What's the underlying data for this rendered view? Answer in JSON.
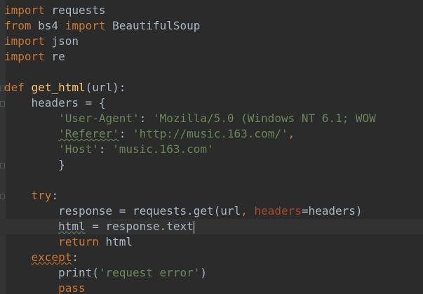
{
  "editor": {
    "language": "python",
    "colors": {
      "background": "#2b2b2b",
      "keyword": "#cc7832",
      "function": "#ffc66d",
      "string": "#6a8759",
      "plain": "#a9b7c6",
      "parameter": "#aa4926"
    },
    "lines": [
      {
        "tokens": [
          {
            "text": "import",
            "kind": "kw"
          },
          {
            "text": " requests",
            "kind": "pl"
          }
        ]
      },
      {
        "tokens": [
          {
            "text": "from",
            "kind": "kw"
          },
          {
            "text": " bs4 ",
            "kind": "pl"
          },
          {
            "text": "import",
            "kind": "kw"
          },
          {
            "text": " BeautifulSoup",
            "kind": "pl"
          }
        ]
      },
      {
        "tokens": [
          {
            "text": "import",
            "kind": "kw"
          },
          {
            "text": " json",
            "kind": "pl"
          }
        ]
      },
      {
        "tokens": [
          {
            "text": "import",
            "kind": "kw"
          },
          {
            "text": " re",
            "kind": "pl"
          }
        ]
      },
      {
        "tokens": []
      },
      {
        "tokens": [
          {
            "text": "def",
            "kind": "kw"
          },
          {
            "text": " ",
            "kind": "pl"
          },
          {
            "text": "get_html",
            "kind": "fn"
          },
          {
            "text": "(url):",
            "kind": "pl"
          }
        ]
      },
      {
        "tokens": [
          {
            "text": "    headers = {",
            "kind": "pl"
          }
        ]
      },
      {
        "tokens": [
          {
            "text": "        ",
            "kind": "pl"
          },
          {
            "text": "'User-Agent'",
            "kind": "str"
          },
          {
            "text": ": ",
            "kind": "pl"
          },
          {
            "text": "'Mozilla/5.0 (Windows NT 6.1; WOW",
            "kind": "str"
          }
        ]
      },
      {
        "tokens": [
          {
            "text": "        ",
            "kind": "pl"
          },
          {
            "text": "'Referer'",
            "kind": "str-under"
          },
          {
            "text": ": ",
            "kind": "pl"
          },
          {
            "text": "'http://music.163.com/'",
            "kind": "str"
          },
          {
            "text": ",",
            "kind": "kw"
          }
        ]
      },
      {
        "tokens": [
          {
            "text": "        ",
            "kind": "pl"
          },
          {
            "text": "'Host'",
            "kind": "str"
          },
          {
            "text": ": ",
            "kind": "pl"
          },
          {
            "text": "'music.163.com'",
            "kind": "str"
          }
        ]
      },
      {
        "tokens": [
          {
            "text": "        }",
            "kind": "pl"
          }
        ]
      },
      {
        "tokens": []
      },
      {
        "tokens": [
          {
            "text": "    ",
            "kind": "pl"
          },
          {
            "text": "try",
            "kind": "kw"
          },
          {
            "text": ":",
            "kind": "pl"
          }
        ]
      },
      {
        "tokens": [
          {
            "text": "        response = requests.get(url",
            "kind": "pl"
          },
          {
            "text": ", ",
            "kind": "kw"
          },
          {
            "text": "headers",
            "kind": "param"
          },
          {
            "text": "=headers)",
            "kind": "pl"
          }
        ]
      },
      {
        "tokens": [
          {
            "text": "        ",
            "kind": "pl"
          },
          {
            "text": "html",
            "kind": "pl-under"
          },
          {
            "text": " = response.text",
            "kind": "pl"
          }
        ],
        "current": true,
        "caret": true
      },
      {
        "tokens": [
          {
            "text": "        ",
            "kind": "pl"
          },
          {
            "text": "return",
            "kind": "kw"
          },
          {
            "text": " html",
            "kind": "pl"
          }
        ]
      },
      {
        "tokens": [
          {
            "text": "    ",
            "kind": "pl"
          },
          {
            "text": "except",
            "kind": "kw-under"
          },
          {
            "text": ":",
            "kind": "pl"
          }
        ]
      },
      {
        "tokens": [
          {
            "text": "        print(",
            "kind": "pl"
          },
          {
            "text": "'request error'",
            "kind": "str"
          },
          {
            "text": ")",
            "kind": "pl"
          }
        ]
      },
      {
        "tokens": [
          {
            "text": "        ",
            "kind": "pl"
          },
          {
            "text": "pass",
            "kind": "kw"
          }
        ]
      }
    ]
  }
}
